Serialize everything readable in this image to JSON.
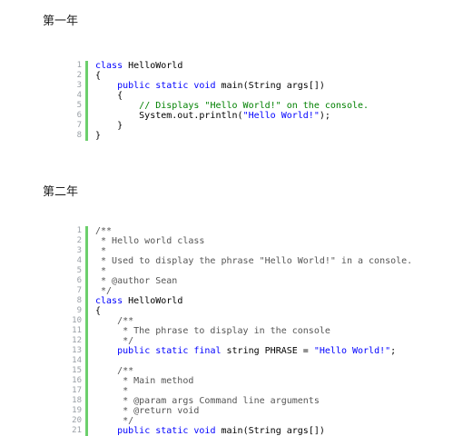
{
  "section1": {
    "title": "第一年",
    "lines": [
      [
        {
          "t": "class",
          "c": "kw"
        },
        {
          "t": " HelloWorld",
          "c": ""
        }
      ],
      [
        {
          "t": "{",
          "c": ""
        }
      ],
      [
        {
          "t": "    ",
          "c": ""
        },
        {
          "t": "public static void",
          "c": "kw"
        },
        {
          "t": " main(String args[])",
          "c": ""
        }
      ],
      [
        {
          "t": "    {",
          "c": ""
        }
      ],
      [
        {
          "t": "        ",
          "c": ""
        },
        {
          "t": "// Displays \"Hello World!\" on the console.",
          "c": "cm"
        }
      ],
      [
        {
          "t": "        System.out.println(",
          "c": ""
        },
        {
          "t": "\"Hello World!\"",
          "c": "str"
        },
        {
          "t": ");",
          "c": ""
        }
      ],
      [
        {
          "t": "    }",
          "c": ""
        }
      ],
      [
        {
          "t": "}",
          "c": ""
        }
      ]
    ]
  },
  "section2": {
    "title": "第二年",
    "lines": [
      [
        {
          "t": "/**",
          "c": "cm2"
        }
      ],
      [
        {
          "t": " * Hello world class",
          "c": "cm2"
        }
      ],
      [
        {
          "t": " *",
          "c": "cm2"
        }
      ],
      [
        {
          "t": " * Used to display the phrase \"Hello World!\" in a console.",
          "c": "cm2"
        }
      ],
      [
        {
          "t": " *",
          "c": "cm2"
        }
      ],
      [
        {
          "t": " * @author Sean",
          "c": "cm2"
        }
      ],
      [
        {
          "t": " */",
          "c": "cm2"
        }
      ],
      [
        {
          "t": "class",
          "c": "kw"
        },
        {
          "t": " HelloWorld",
          "c": ""
        }
      ],
      [
        {
          "t": "{",
          "c": ""
        }
      ],
      [
        {
          "t": "    /**",
          "c": "cm2"
        }
      ],
      [
        {
          "t": "     * The phrase to display in the console",
          "c": "cm2"
        }
      ],
      [
        {
          "t": "     */",
          "c": "cm2"
        }
      ],
      [
        {
          "t": "    ",
          "c": ""
        },
        {
          "t": "public static final",
          "c": "kw"
        },
        {
          "t": " string PHRASE = ",
          "c": ""
        },
        {
          "t": "\"Hello World!\"",
          "c": "str"
        },
        {
          "t": ";",
          "c": ""
        }
      ],
      [
        {
          "t": "",
          "c": ""
        }
      ],
      [
        {
          "t": "    /**",
          "c": "cm2"
        }
      ],
      [
        {
          "t": "     * Main method",
          "c": "cm2"
        }
      ],
      [
        {
          "t": "     *",
          "c": "cm2"
        }
      ],
      [
        {
          "t": "     * @param args Command line arguments",
          "c": "cm2"
        }
      ],
      [
        {
          "t": "     * @return void",
          "c": "cm2"
        }
      ],
      [
        {
          "t": "     */",
          "c": "cm2"
        }
      ],
      [
        {
          "t": "    ",
          "c": ""
        },
        {
          "t": "public static void",
          "c": "kw"
        },
        {
          "t": " main(String args[])",
          "c": ""
        }
      ]
    ]
  }
}
